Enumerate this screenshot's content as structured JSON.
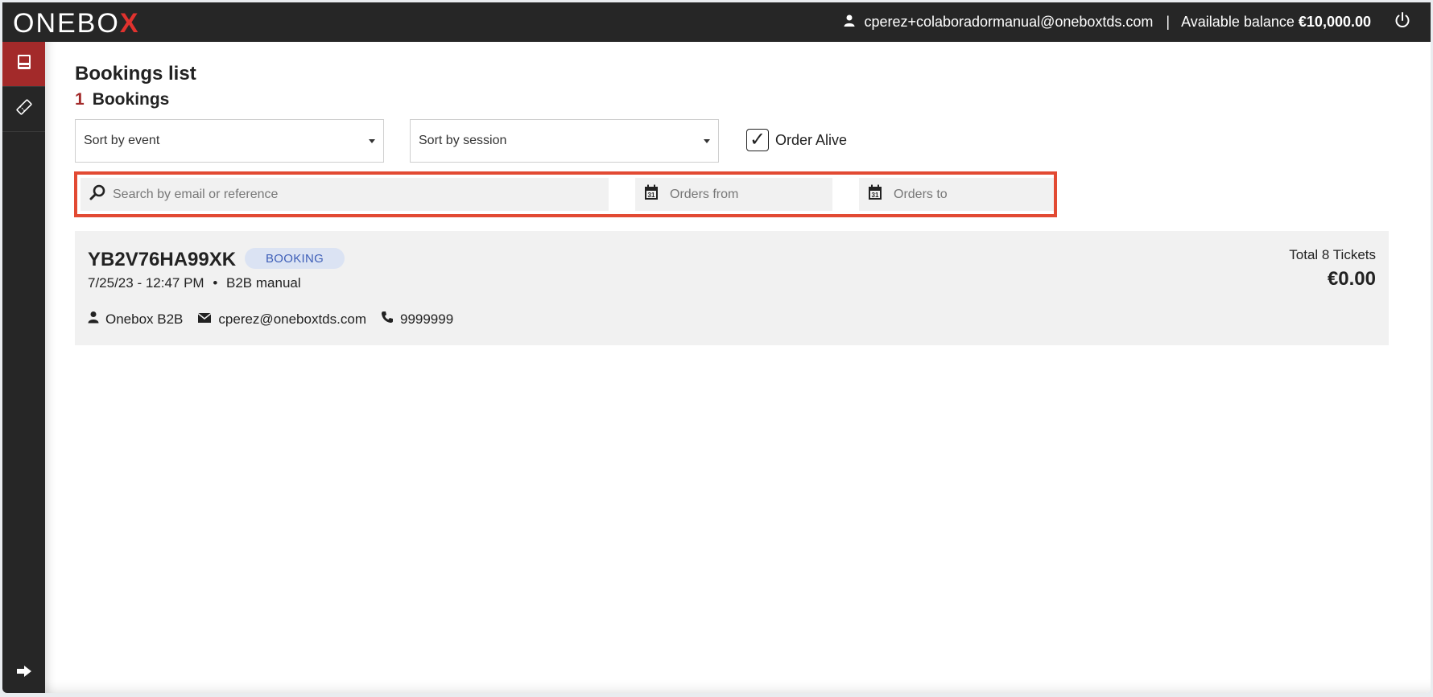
{
  "header": {
    "logo_text_main": "ONEBO",
    "logo_text_accent": "X",
    "user_email": "cperez+colaboradormanual@oneboxtds.com",
    "separator": "|",
    "balance_label": "Available balance",
    "balance_value": "€10,000.00",
    "user_icon": "user-icon",
    "power_icon": "power-icon"
  },
  "sidebar": {
    "items": [
      {
        "icon": "bookings-icon",
        "active": true
      },
      {
        "icon": "ticket-icon",
        "active": false
      }
    ],
    "bottom_icon": "arrow-right-icon"
  },
  "page": {
    "title": "Bookings list",
    "count": "1",
    "count_label": "Bookings"
  },
  "filters": {
    "sort_event_label": "Sort by event",
    "sort_session_label": "Sort by session",
    "order_alive_label": "Order Alive",
    "order_alive_checked": true,
    "checkmark": "✓",
    "search_placeholder": "Search by email or reference",
    "orders_from_placeholder": "Orders from",
    "orders_to_placeholder": "Orders to",
    "highlight_color": "#e24a33"
  },
  "bookings": [
    {
      "reference": "YB2V76HA99XK",
      "status": "BOOKING",
      "datetime": "7/25/23 - 12:47 PM",
      "bullet": "•",
      "channel": "B2B manual",
      "client_name": "Onebox B2B",
      "email": "cperez@oneboxtds.com",
      "phone": "9999999",
      "total_label": "Total 8 Tickets",
      "total_amount": "€0.00"
    }
  ],
  "colors": {
    "topbar": "#262626",
    "accent_red": "#a32a2a",
    "badge_bg": "#dbe3f3",
    "badge_text": "#3e5fb8"
  }
}
